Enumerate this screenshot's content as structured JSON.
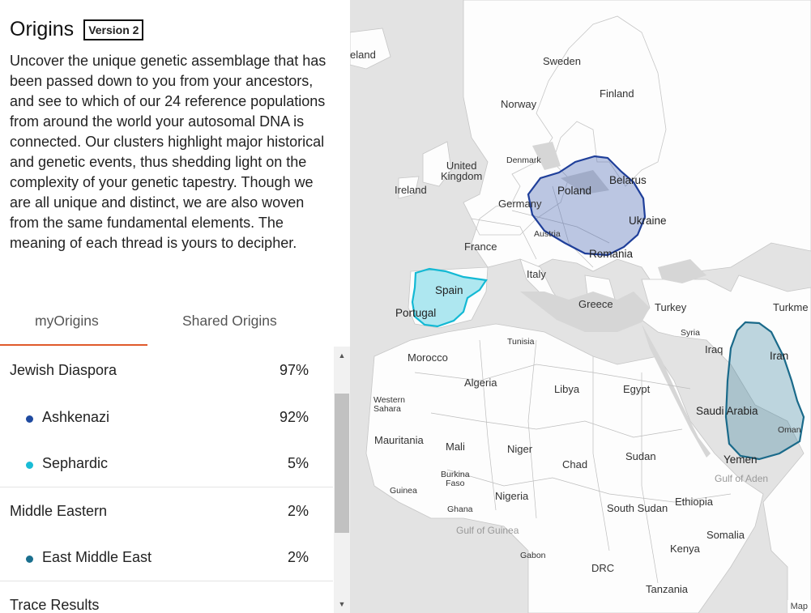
{
  "header": {
    "title": "Origins",
    "version_badge": "Version 2"
  },
  "description": "Uncover the unique genetic assemblage that has been passed down to you from your ancestors, and see to which of our 24 reference populations from around the world your autosomal DNA is connected. Our clusters highlight major historical and genetic events, thus shedding light on the complexity of your genetic tapestry. Though we are all unique and distinct, we are also woven from the same fundamental elements. The meaning of each thread is yours to decipher.",
  "tabs": [
    {
      "label": "myOrigins",
      "active": true
    },
    {
      "label": "Shared Origins",
      "active": false
    }
  ],
  "origins": [
    {
      "name": "Jewish Diaspora",
      "percent": "97%",
      "level": "group"
    },
    {
      "name": "Ashkenazi",
      "percent": "92%",
      "level": "sub",
      "color": "#1f4aa0"
    },
    {
      "name": "Sephardic",
      "percent": "5%",
      "level": "sub",
      "color": "#19bcd6"
    },
    {
      "name": "Middle Eastern",
      "percent": "2%",
      "level": "group"
    },
    {
      "name": "East Middle East",
      "percent": "2%",
      "level": "sub",
      "color": "#1a6f8e"
    }
  ],
  "trace_results_label": "Trace Results",
  "map": {
    "labels": {
      "iceland": "eland",
      "sweden": "Sweden",
      "finland": "Finland",
      "norway": "Norway",
      "denmark": "Denmark",
      "uk": "United\nKingdom",
      "ireland": "Ireland",
      "belarus": "Belarus",
      "poland": "Poland",
      "germany": "Germany",
      "ukraine": "Ukraine",
      "austria": "Austria",
      "france": "France",
      "romania": "Romania",
      "spain": "Spain",
      "portugal": "Portugal",
      "italy": "Italy",
      "greece": "Greece",
      "turkey": "Turkey",
      "turkmen": "Turkme",
      "syria": "Syria",
      "iraq": "Iraq",
      "iran": "Iran",
      "tunisia": "Tunisia",
      "morocco": "Morocco",
      "algeria": "Algeria",
      "libya": "Libya",
      "egypt": "Egypt",
      "western_sahara": "Western\nSahara",
      "saudi_arabia": "Saudi Arabia",
      "oman": "Oman",
      "mauritania": "Mauritania",
      "mali": "Mali",
      "niger": "Niger",
      "chad": "Chad",
      "sudan": "Sudan",
      "yemen": "Yemen",
      "burkina_faso": "Burkina\nFaso",
      "guinea": "Guinea",
      "ghana": "Ghana",
      "nigeria": "Nigeria",
      "south_sudan": "South Sudan",
      "ethiopia": "Ethiopia",
      "somalia": "Somalia",
      "kenya": "Kenya",
      "gabon": "Gabon",
      "drc": "DRC",
      "tanzania": "Tanzania",
      "gulf_aden": "Gulf of Aden",
      "gulf_guinea": "Gulf of Guinea"
    },
    "map_link": "Map"
  }
}
